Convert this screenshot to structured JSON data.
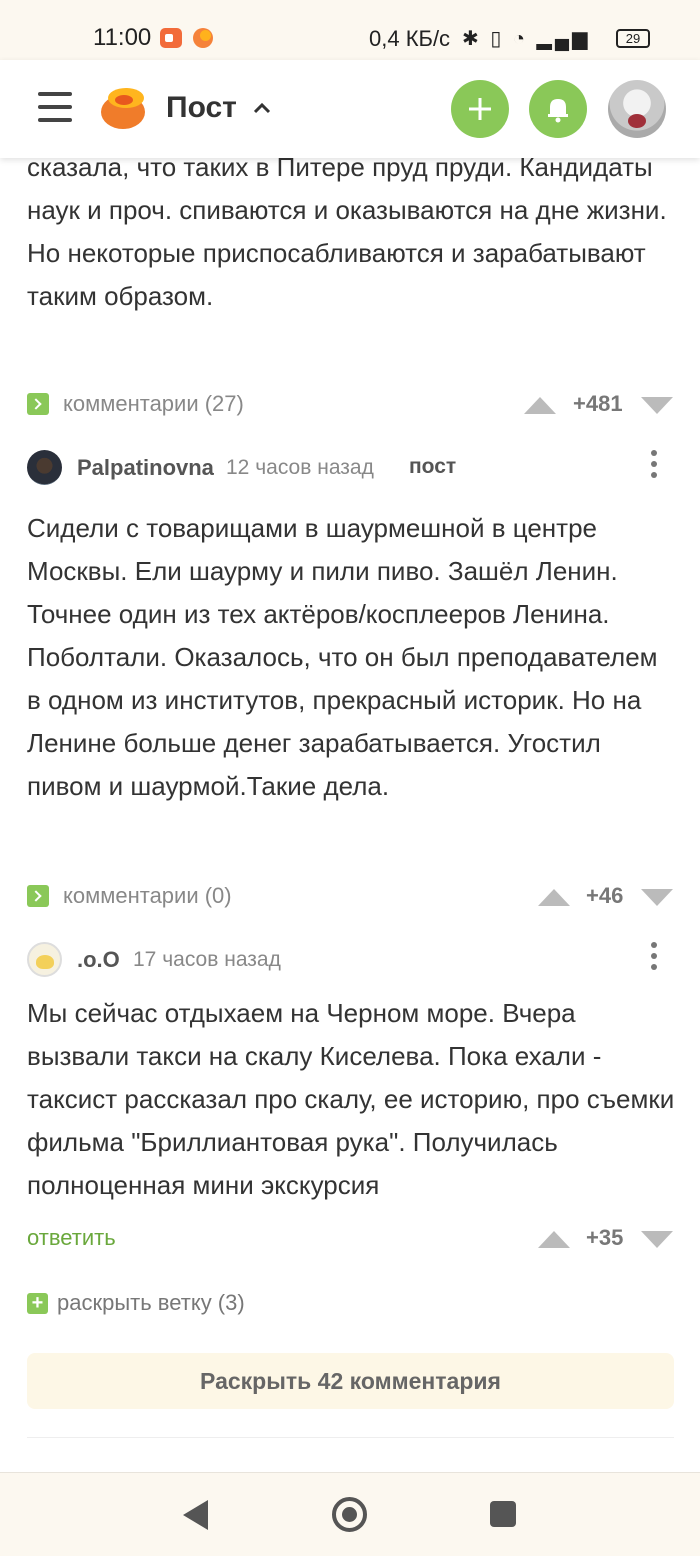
{
  "status_bar": {
    "time": "11:00",
    "net_speed": "0,4 КБ/с",
    "icons": "✱ ▯ ◔ ▂▄▆",
    "battery": "29"
  },
  "header": {
    "title": "Пост",
    "accent_color": "#8ac858"
  },
  "comments": [
    {
      "text": "сказала, что таких в Питере пруд пруди. Кандидаты наук и проч. спиваются и оказываются на дне жизни. Но некоторые приспосабливаются и зарабатывают таким образом.",
      "comments_link": "комментарии (27)",
      "score": "+481"
    },
    {
      "author": "Palpatinovna",
      "time": "12 часов назад",
      "tag": "пост",
      "text": "Сидели с товарищами в шаурмешной в центре Москвы. Ели шаурму и пили пиво. Зашёл Ленин. Точнее один из тех актёров/косплееров Ленина. Поболтали. Оказалось, что он был преподавателем в одном из институтов, прекрасный историк. Но на Ленине больше денег зарабатывается. Угостил пивом и шаурмой.Такие дела.",
      "comments_link": "комментарии (0)",
      "score": "+46"
    },
    {
      "author": ".o.O",
      "time": "17 часов назад",
      "text": "Мы сейчас отдыхаем на Черном море. Вчера вызвали такси на скалу Киселева. Пока ехали - таксист рассказал про скалу, ее историю, про съемки фильма \"Бриллиантовая рука\". Получилась полноценная мини экскурсия",
      "reply_link": "ответить",
      "score": "+35"
    }
  ],
  "expand_branch": "раскрыть ветку (3)",
  "expand_all": "Раскрыть 42 комментария"
}
